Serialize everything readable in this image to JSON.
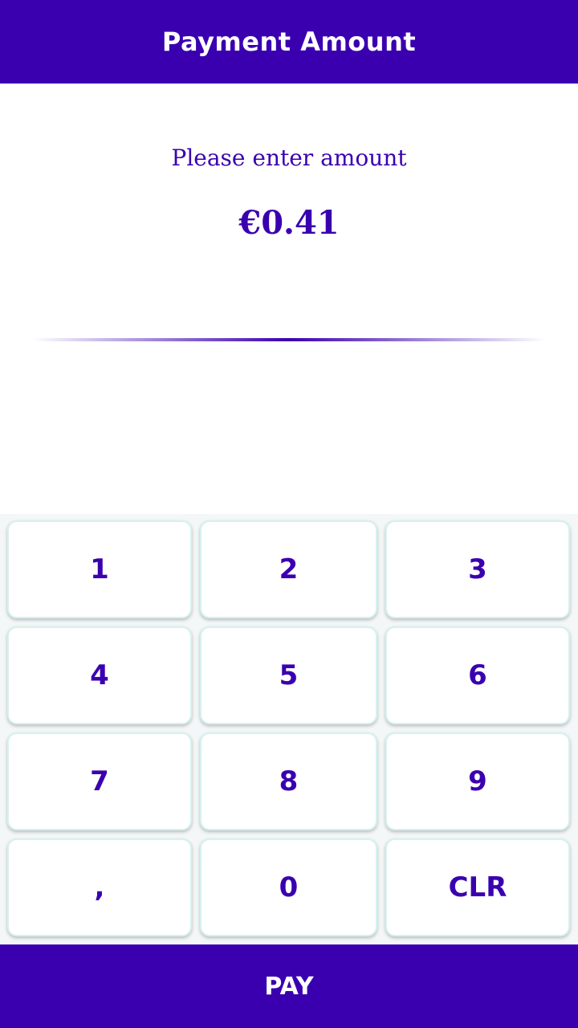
{
  "header": {
    "title": "Payment Amount"
  },
  "entry": {
    "prompt": "Please enter amount",
    "amount": "€0.41"
  },
  "keypad": {
    "keys": [
      "1",
      "2",
      "3",
      "4",
      "5",
      "6",
      "7",
      "8",
      "9",
      ",",
      "0",
      "CLR"
    ]
  },
  "pay_button": {
    "label": "PAY"
  },
  "colors": {
    "primary": "#3a00b0",
    "key_border": "#d4f2f0",
    "background": "#ffffff"
  }
}
